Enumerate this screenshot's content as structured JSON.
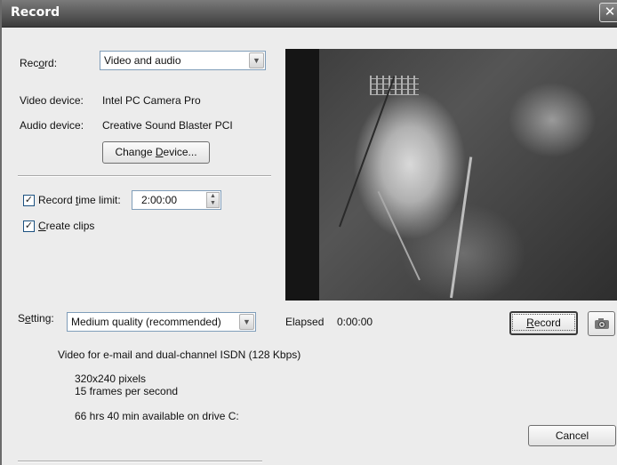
{
  "window": {
    "title": "Record",
    "close_label": "✕"
  },
  "record_row": {
    "label_prefix": "Rec",
    "label_underline": "o",
    "label_suffix": "rd:",
    "value": "Video and audio"
  },
  "devices": {
    "video_label": "Video device:",
    "video_value": "Intel PC Camera Pro",
    "audio_label": "Audio device:",
    "audio_value": "Creative Sound Blaster PCI",
    "change_prefix": "Change ",
    "change_underline": "D",
    "change_suffix": "evice..."
  },
  "time_limit": {
    "checked": true,
    "label_prefix": "Record ",
    "label_underline": "t",
    "label_suffix": "ime limit:",
    "value": "2:00:00"
  },
  "create_clips": {
    "checked": true,
    "label_underline": "C",
    "label_suffix": "reate clips"
  },
  "setting": {
    "label_prefix": "S",
    "label_underline": "e",
    "label_suffix": "tting:",
    "value": "Medium quality (recommended)"
  },
  "elapsed": {
    "label": "Elapsed",
    "value": "0:00:00"
  },
  "record_button": {
    "label_underline": "R",
    "label_suffix": "ecord"
  },
  "snapshot_button": {
    "icon": "camera-icon"
  },
  "info": {
    "description": "Video for e-mail and dual-channel ISDN (128 Kbps)",
    "resolution": "320x240 pixels",
    "frame_rate": "15 frames per second",
    "available": "66 hrs  40 min available on drive C:"
  },
  "cancel_button": {
    "label": "Cancel"
  },
  "colors": {
    "title_bar": "#4a4a4a",
    "dialog_bg": "#ececec"
  }
}
